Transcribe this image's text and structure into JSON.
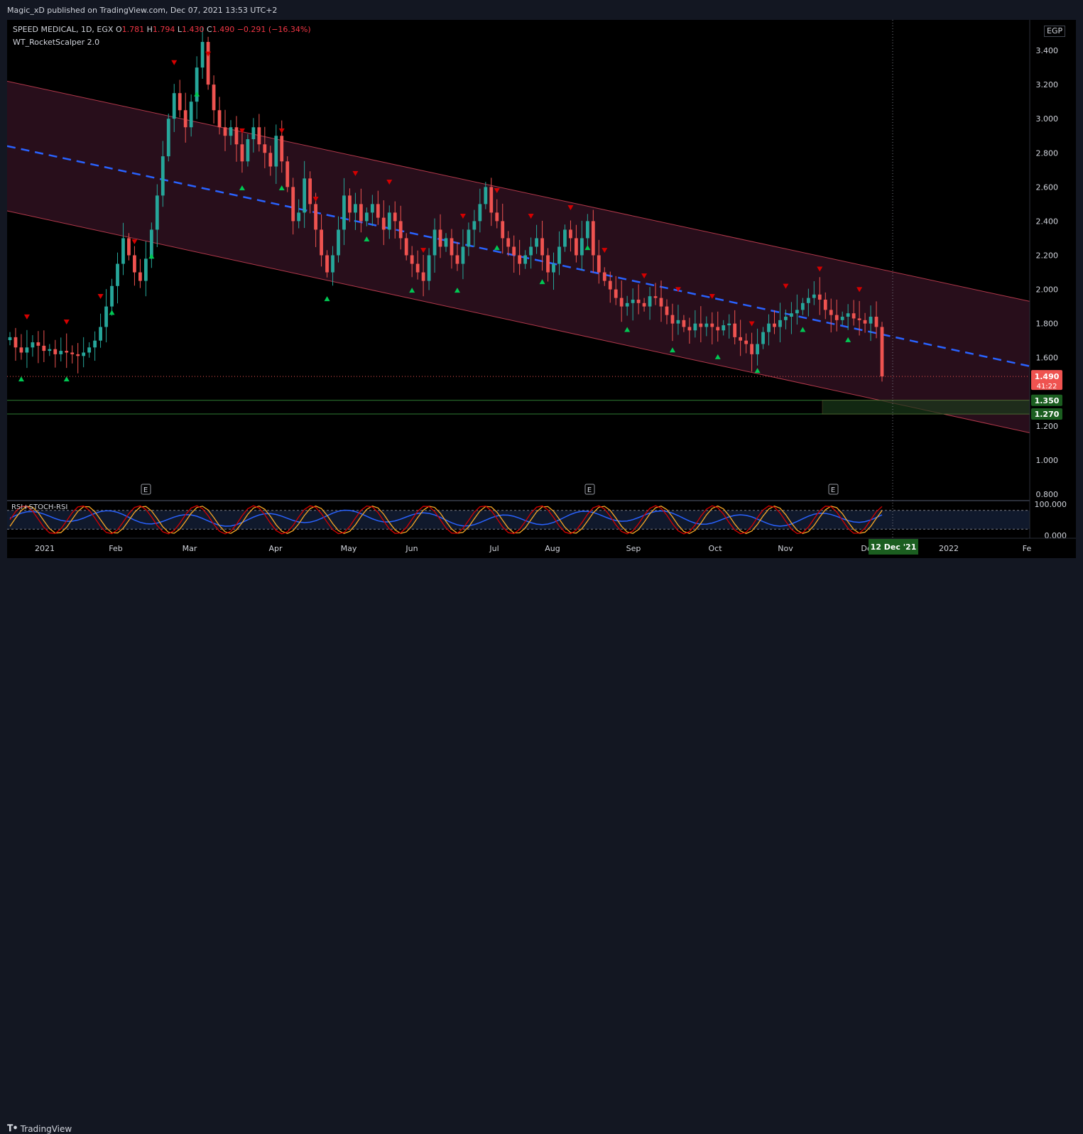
{
  "header": {
    "publisher": "Magic_xD published on TradingView.com, Dec 07, 2021 13:53 UTC+2"
  },
  "legend": {
    "symbol": "SPEED MEDICAL, 1D, EGX",
    "open_label": "O",
    "open": "1.781",
    "high_label": "H",
    "high": "1.794",
    "low_label": "L",
    "low": "1.430",
    "close_label": "C",
    "close": "1.490",
    "change": "−0.291 (−16.34%)",
    "indicator": "WT_RocketScalper 2.0",
    "currency": "EGP"
  },
  "footer": {
    "brand": "TradingView"
  },
  "colors": {
    "background": "#000000",
    "bull": "#26a69a",
    "bear": "#ef5350",
    "channel_fill": "#2a0f1c",
    "channel_line": "#b0384a",
    "midline": "#2962ff",
    "buy_signal": "#00c853",
    "sell_signal": "#d50000"
  },
  "chart_data": {
    "type": "candlestick",
    "symbol": "SPEED MEDICAL",
    "interval": "1D",
    "exchange": "EGX",
    "ylim": [
      0.8,
      3.6
    ],
    "y_ticks": [
      "3.400",
      "3.200",
      "3.000",
      "2.800",
      "2.600",
      "2.400",
      "2.200",
      "2.000",
      "1.800",
      "1.600",
      "1.400",
      "1.200",
      "1.000",
      "0.800"
    ],
    "x_ticks": [
      "2021",
      "Feb",
      "Mar",
      "Apr",
      "May",
      "Jun",
      "Jul",
      "Aug",
      "Sep",
      "Oct",
      "Nov",
      "De",
      "2022",
      "Fe"
    ],
    "crosshair_date": "12 Dec '21",
    "last_price": "1.490",
    "countdown": "41:22",
    "support_levels": [
      {
        "label": "1.350",
        "value": 1.35
      },
      {
        "label": "1.270",
        "value": 1.27
      }
    ],
    "earnings_markers": [
      "E",
      "E",
      "E"
    ],
    "channel": {
      "upper": [
        [
          0,
          3.22
        ],
        [
          1,
          1.93
        ]
      ],
      "lower": [
        [
          0,
          2.46
        ],
        [
          1,
          1.16
        ]
      ],
      "mid": [
        [
          0,
          2.84
        ],
        [
          1,
          1.55
        ]
      ]
    },
    "closes": [
      1.72,
      1.66,
      1.63,
      1.66,
      1.69,
      1.67,
      1.64,
      1.65,
      1.62,
      1.64,
      1.63,
      1.62,
      1.61,
      1.63,
      1.66,
      1.7,
      1.78,
      1.9,
      2.02,
      2.15,
      2.3,
      2.2,
      2.1,
      2.05,
      2.18,
      2.35,
      2.55,
      2.78,
      3.0,
      3.15,
      3.05,
      2.95,
      3.1,
      3.3,
      3.45,
      3.2,
      3.05,
      2.95,
      2.9,
      2.95,
      2.85,
      2.75,
      2.88,
      2.95,
      2.85,
      2.8,
      2.72,
      2.9,
      2.75,
      2.6,
      2.4,
      2.45,
      2.65,
      2.5,
      2.35,
      2.2,
      2.1,
      2.2,
      2.35,
      2.55,
      2.45,
      2.5,
      2.4,
      2.45,
      2.5,
      2.42,
      2.35,
      2.45,
      2.4,
      2.3,
      2.2,
      2.15,
      2.1,
      2.05,
      2.2,
      2.35,
      2.25,
      2.3,
      2.2,
      2.15,
      2.25,
      2.35,
      2.4,
      2.5,
      2.6,
      2.45,
      2.4,
      2.3,
      2.25,
      2.2,
      2.15,
      2.2,
      2.25,
      2.3,
      2.2,
      2.1,
      2.15,
      2.25,
      2.35,
      2.3,
      2.2,
      2.3,
      2.4,
      2.2,
      2.1,
      2.05,
      2.0,
      1.95,
      1.9,
      1.92,
      1.94,
      1.92,
      1.9,
      1.96,
      1.95,
      1.9,
      1.85,
      1.8,
      1.82,
      1.78,
      1.76,
      1.8,
      1.78,
      1.8,
      1.78,
      1.76,
      1.79,
      1.8,
      1.72,
      1.7,
      1.68,
      1.62,
      1.68,
      1.75,
      1.8,
      1.78,
      1.82,
      1.84,
      1.86,
      1.88,
      1.92,
      1.95,
      1.97,
      1.94,
      1.88,
      1.85,
      1.82,
      1.84,
      1.86,
      1.83,
      1.82,
      1.8,
      1.84,
      1.78,
      1.49
    ],
    "sell_signals_count": 24,
    "buy_signals_count": 20,
    "rsi_panel": {
      "name": "RSI+STOCH-RSI",
      "ylim": [
        0,
        100
      ],
      "y_ticks": [
        "100.000",
        "0.000"
      ],
      "upper_band": 80,
      "lower_band": 20
    }
  }
}
